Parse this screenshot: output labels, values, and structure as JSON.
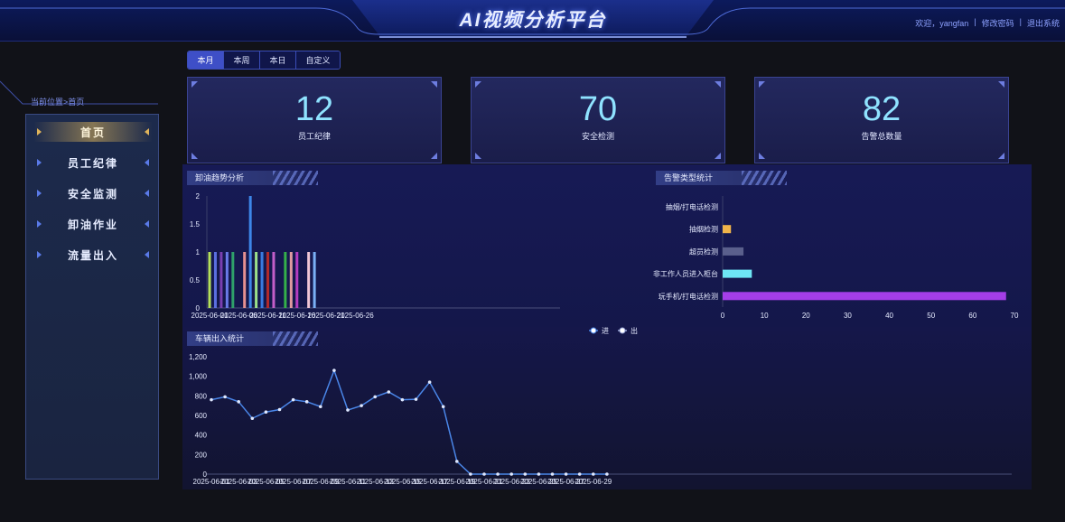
{
  "header": {
    "title": "AI视频分析平台",
    "welcome": "欢迎，yangfan",
    "sep1": "|",
    "change_password": "修改密码",
    "sep2": "|",
    "logout": "退出系统"
  },
  "breadcrumb": "当前位置>首页",
  "sidebar": {
    "items": [
      {
        "label": "首页",
        "active": true
      },
      {
        "label": "员工纪律",
        "active": false
      },
      {
        "label": "安全监测",
        "active": false
      },
      {
        "label": "卸油作业",
        "active": false
      },
      {
        "label": "流量出入",
        "active": false
      }
    ]
  },
  "tabs": [
    {
      "label": "本月",
      "active": true
    },
    {
      "label": "本周",
      "active": false
    },
    {
      "label": "本日",
      "active": false
    },
    {
      "label": "自定义",
      "active": false
    }
  ],
  "stats": [
    {
      "value": "12",
      "label": "员工纪律"
    },
    {
      "value": "70",
      "label": "安全检测"
    },
    {
      "value": "82",
      "label": "告警总数量"
    }
  ],
  "sections": {
    "unload_title": "卸油趋势分析",
    "alarm_title": "告警类型统计",
    "vehicle_title": "车辆出入统计"
  },
  "chart_data": [
    {
      "type": "bar",
      "title": "卸油趋势分析",
      "x_ticks": [
        "2025-06-01",
        "2025-06-06",
        "2025-06-11",
        "2025-06-16",
        "2025-06-21",
        "2025-06-26"
      ],
      "y_ticks": [
        "0",
        "0.5",
        "1",
        "1.5",
        "2"
      ],
      "ylim": [
        0,
        2
      ],
      "xlim_days": [
        1,
        31
      ],
      "bars": [
        {
          "day": 1,
          "value": 1,
          "color": "#b5e05a"
        },
        {
          "day": 2,
          "value": 1,
          "color": "#5b6fe0"
        },
        {
          "day": 3,
          "value": 1,
          "color": "#7a3fb0"
        },
        {
          "day": 4,
          "value": 1,
          "color": "#6a7ae8"
        },
        {
          "day": 5,
          "value": 1,
          "color": "#2fa06a"
        },
        {
          "day": 7,
          "value": 1,
          "color": "#e59090"
        },
        {
          "day": 8,
          "value": 2,
          "color": "#3d86e8"
        },
        {
          "day": 9,
          "value": 1,
          "color": "#9be08a"
        },
        {
          "day": 10,
          "value": 1,
          "color": "#3a7ae0"
        },
        {
          "day": 11,
          "value": 1,
          "color": "#b02a2a"
        },
        {
          "day": 12,
          "value": 1,
          "color": "#c25ec8"
        },
        {
          "day": 14,
          "value": 1,
          "color": "#35b04a"
        },
        {
          "day": 15,
          "value": 1,
          "color": "#e09aa0"
        },
        {
          "day": 16,
          "value": 1,
          "color": "#b43cc0"
        },
        {
          "day": 18,
          "value": 1,
          "color": "#f0c6d6"
        },
        {
          "day": 19,
          "value": 1,
          "color": "#7ab0f5"
        }
      ]
    },
    {
      "type": "bar",
      "orientation": "horizontal",
      "title": "告警类型统计",
      "categories": [
        "抽烟/打电话检测",
        "抽烟检测",
        "超员检测",
        "非工作人员进入柜台",
        "玩手机/打电话检测"
      ],
      "values": [
        0,
        2,
        5,
        7,
        68
      ],
      "colors": [
        "#6c6cff",
        "#f0b44a",
        "#5a5f8c",
        "#6ee6f5",
        "#a43ee8"
      ],
      "x_ticks": [
        "0",
        "10",
        "20",
        "30",
        "40",
        "50",
        "60",
        "70"
      ],
      "xlim": [
        0,
        70
      ]
    },
    {
      "type": "line",
      "title": "车辆出入统计",
      "legend": [
        "进",
        "出"
      ],
      "legend_position": "top-center",
      "x_ticks": [
        "2025-06-01",
        "2025-06-03",
        "2025-06-05",
        "2025-06-07",
        "2025-06-09",
        "2025-06-11",
        "2025-06-13",
        "2025-06-15",
        "2025-06-17",
        "2025-06-19",
        "2025-06-21",
        "2025-06-23",
        "2025-06-25",
        "2025-06-27",
        "2025-06-29"
      ],
      "y_ticks": [
        "0",
        "200",
        "400",
        "600",
        "800",
        "1,000",
        "1,200"
      ],
      "ylim": [
        0,
        1200
      ],
      "series": [
        {
          "name": "进",
          "color": "#4a86e8",
          "values": [
            760,
            790,
            740,
            570,
            635,
            660,
            760,
            740,
            690,
            1060,
            655,
            700,
            790,
            840,
            760,
            765,
            940,
            690,
            130,
            0,
            0,
            0,
            0,
            0,
            0,
            0,
            0,
            0,
            0,
            0
          ]
        }
      ]
    }
  ]
}
